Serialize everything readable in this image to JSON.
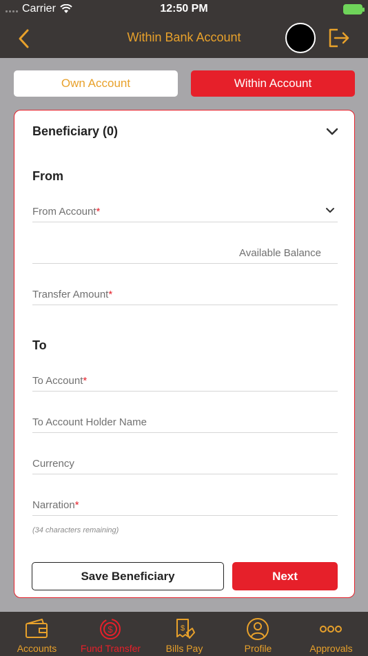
{
  "status": {
    "carrier": "Carrier",
    "time": "12:50 PM"
  },
  "header": {
    "title": "Within Bank Account"
  },
  "tabs": {
    "own": "Own Account",
    "within": "Within Account"
  },
  "card": {
    "beneficiary": "Beneficiary (0)",
    "from_section": "From",
    "from_account": "From Account",
    "available_balance": "Available Balance",
    "transfer_amount": "Transfer Amount",
    "to_section": "To",
    "to_account": "To Account",
    "to_holder": "To Account Holder Name",
    "currency": "Currency",
    "narration": "Narration",
    "remaining": "(34 characters remaining)",
    "required_mark": "*",
    "save_button": "Save Beneficiary",
    "next_button": "Next"
  },
  "tabbar": {
    "items": [
      {
        "label": "Accounts",
        "icon": "wallet-icon"
      },
      {
        "label": "Fund Transfer",
        "icon": "transfer-icon",
        "active": true
      },
      {
        "label": "Bills Pay",
        "icon": "bill-icon"
      },
      {
        "label": "Profile",
        "icon": "profile-icon"
      },
      {
        "label": "Approvals",
        "icon": "more-icon"
      }
    ]
  },
  "colors": {
    "accent": "#e8a12b",
    "primary": "#e6202a",
    "dark": "#3b3736"
  }
}
